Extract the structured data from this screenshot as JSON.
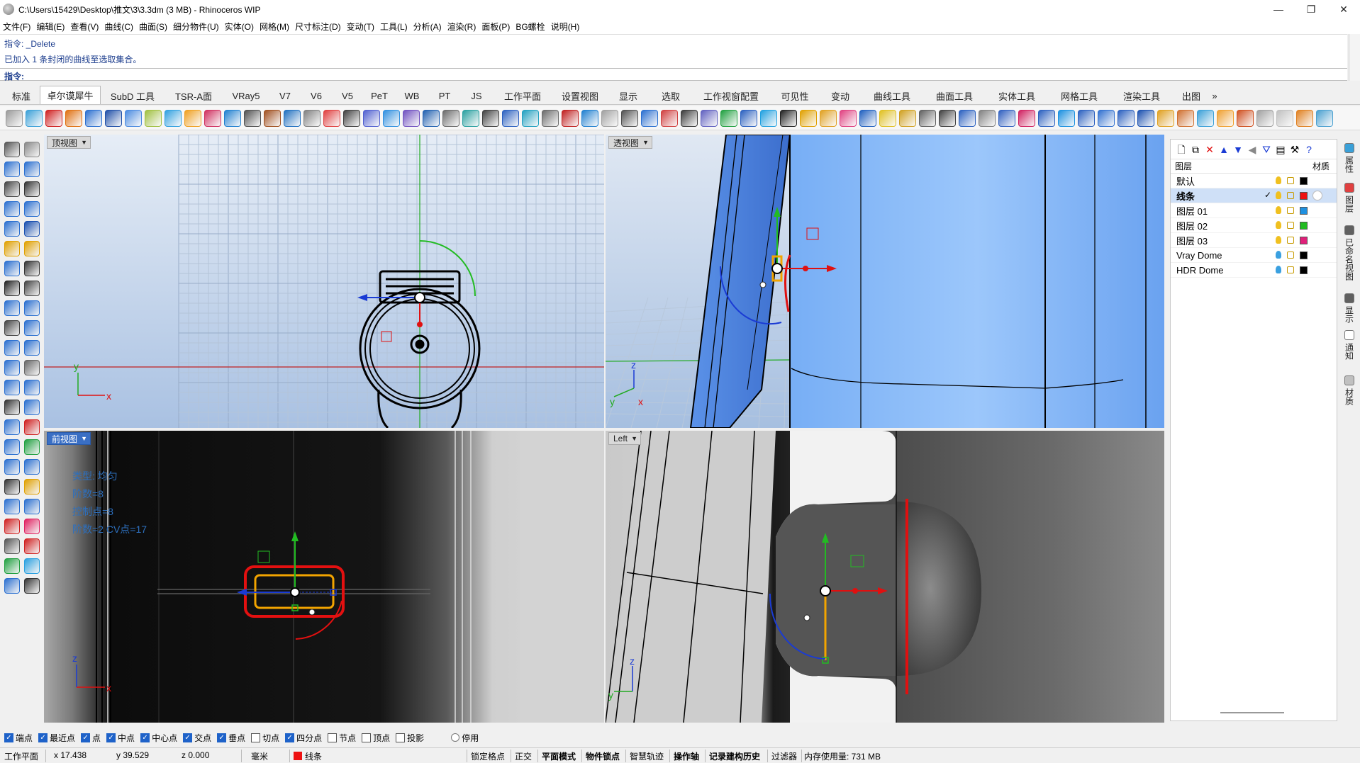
{
  "window": {
    "title": "C:\\Users\\15429\\Desktop\\推文\\3\\3.3dm (3 MB) - Rhinoceros WIP"
  },
  "menu": [
    "文件(F)",
    "编辑(E)",
    "查看(V)",
    "曲线(C)",
    "曲面(S)",
    "细分物件(U)",
    "实体(O)",
    "网格(M)",
    "尺寸标注(D)",
    "变动(T)",
    "工具(L)",
    "分析(A)",
    "渲染(R)",
    "面板(P)",
    "BG螺栓",
    "说明(H)"
  ],
  "command": {
    "history_1": "指令: _Delete",
    "history_2": "已加入 1 条封闭的曲线至选取集合。",
    "prompt": "指令:"
  },
  "tabs": [
    "标准",
    "卓尔谟犀牛",
    "SubD 工具",
    "TSR-A面",
    "VRay5",
    "V7",
    "V6",
    "V5",
    "PeT",
    "WB",
    "PT",
    "JS",
    "工作平面",
    "设置视图",
    "显示",
    "选取",
    "工作视窗配置",
    "可见性",
    "变动",
    "曲线工具",
    "曲面工具",
    "实体工具",
    "网格工具",
    "渲染工具",
    "出图"
  ],
  "tab_more": "»",
  "active_tab": "卓尔谟犀牛",
  "viewports": {
    "top": {
      "label": "顶视图"
    },
    "perspective": {
      "label": "透视图"
    },
    "front": {
      "label": "前视图"
    },
    "left": {
      "label": "Left"
    }
  },
  "front_overlay": [
    "类型: 均匀",
    "阶数=8",
    "控制点=8",
    "阶数=2 CV点=17"
  ],
  "axes": {
    "x": "x",
    "y": "y",
    "z": "z"
  },
  "layers_panel": {
    "header": "图层",
    "material_col": "材质",
    "layers": [
      {
        "name": "默认",
        "color": "#000000",
        "current": false
      },
      {
        "name": "线条",
        "color": "#ee1111",
        "current": true
      },
      {
        "name": "图层 01",
        "color": "#1e90e0",
        "current": false
      },
      {
        "name": "图层 02",
        "color": "#22bb22",
        "current": false
      },
      {
        "name": "图层 03",
        "color": "#e0207a",
        "current": false
      },
      {
        "name": "Vray Dome",
        "color": "#000000",
        "current": false
      },
      {
        "name": "HDR Dome",
        "color": "#000000",
        "current": false
      }
    ]
  },
  "side_tabs": [
    "属性",
    "图层",
    "已命名视图",
    "显示",
    "通知",
    "材质"
  ],
  "osnaps": [
    {
      "label": "端点",
      "on": true
    },
    {
      "label": "最近点",
      "on": true
    },
    {
      "label": "点",
      "on": true
    },
    {
      "label": "中点",
      "on": true
    },
    {
      "label": "中心点",
      "on": true
    },
    {
      "label": "交点",
      "on": true
    },
    {
      "label": "垂点",
      "on": true
    },
    {
      "label": "切点",
      "on": false
    },
    {
      "label": "四分点",
      "on": true
    },
    {
      "label": "节点",
      "on": false
    },
    {
      "label": "顶点",
      "on": false
    },
    {
      "label": "投影",
      "on": false
    },
    {
      "label": "停用",
      "on": false
    }
  ],
  "status": {
    "cplane": "工作平面",
    "x": "x 17.438",
    "y": "y 39.529",
    "z": "z 0.000",
    "units": "毫米",
    "layer": "线条",
    "grid_snap": "锁定格点",
    "ortho": "正交",
    "planar": "平面模式",
    "osnap": "物件锁点",
    "smarttrack": "智慧轨迹",
    "gumball": "操作轴",
    "history": "记录建构历史",
    "filter": "过滤器",
    "memory": "内存使用量: 731 MB"
  },
  "colors": {
    "accent": "#3a6fc4",
    "viewport_bg_top": "#dce6f2",
    "viewport_bg_bottom": "#9fb8dc",
    "red": "#ee1111",
    "green": "#22bb22",
    "blue": "#1a3bd4",
    "orange": "#f2a400"
  }
}
